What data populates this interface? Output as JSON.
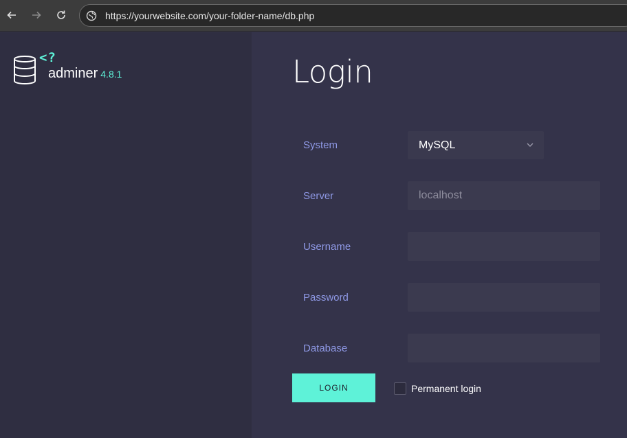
{
  "browser": {
    "url": "https://yourwebsite.com/your-folder-name/db.php"
  },
  "app": {
    "logo_tag": "<?",
    "name": "adminer",
    "version": "4.8.1"
  },
  "login": {
    "title": "Login",
    "fields": {
      "system": {
        "label": "System",
        "value": "MySQL"
      },
      "server": {
        "label": "Server",
        "placeholder": "localhost",
        "value": ""
      },
      "username": {
        "label": "Username",
        "value": ""
      },
      "password": {
        "label": "Password",
        "value": ""
      },
      "database": {
        "label": "Database",
        "value": ""
      }
    },
    "submit_label": "LOGIN",
    "permanent_label": "Permanent login",
    "permanent_checked": false
  },
  "colors": {
    "accent": "#5ef2d8",
    "label": "#8f99e6",
    "sidebar_bg": "#2f2e41",
    "main_bg": "#34334a"
  }
}
